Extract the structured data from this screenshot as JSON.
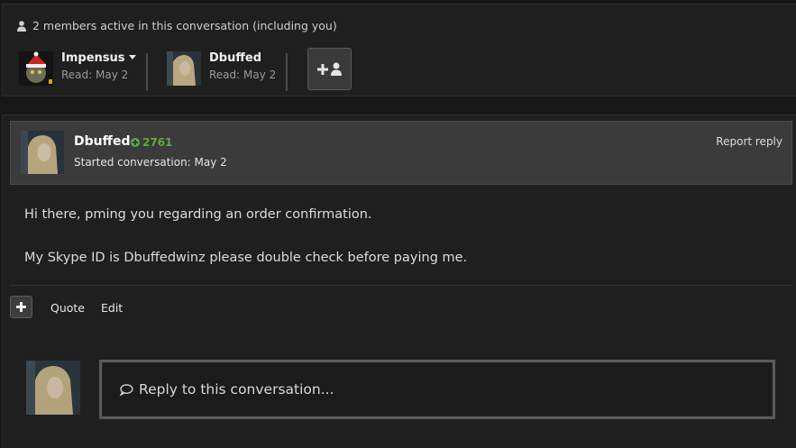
{
  "members": {
    "summary": "2 members active in this conversation (including you)",
    "list": [
      {
        "name": "Impensus",
        "read": "Read: May 2"
      },
      {
        "name": "Dbuffed",
        "read": "Read: May 2"
      }
    ]
  },
  "message": {
    "author": "Dbuffed",
    "reputation": "2761",
    "started": "Started conversation: May 2",
    "report": "Report reply",
    "paragraphs": [
      "Hi there, pming you regarding an order confirmation.",
      "My Skype ID is Dbuffedwinz please double check before paying me."
    ],
    "actions": {
      "quote": "Quote",
      "edit": "Edit"
    }
  },
  "reply": {
    "placeholder": "Reply to this conversation..."
  },
  "colors": {
    "reputation": "#5cab3c",
    "background": "#171717",
    "panel": "#1f1f1f"
  }
}
